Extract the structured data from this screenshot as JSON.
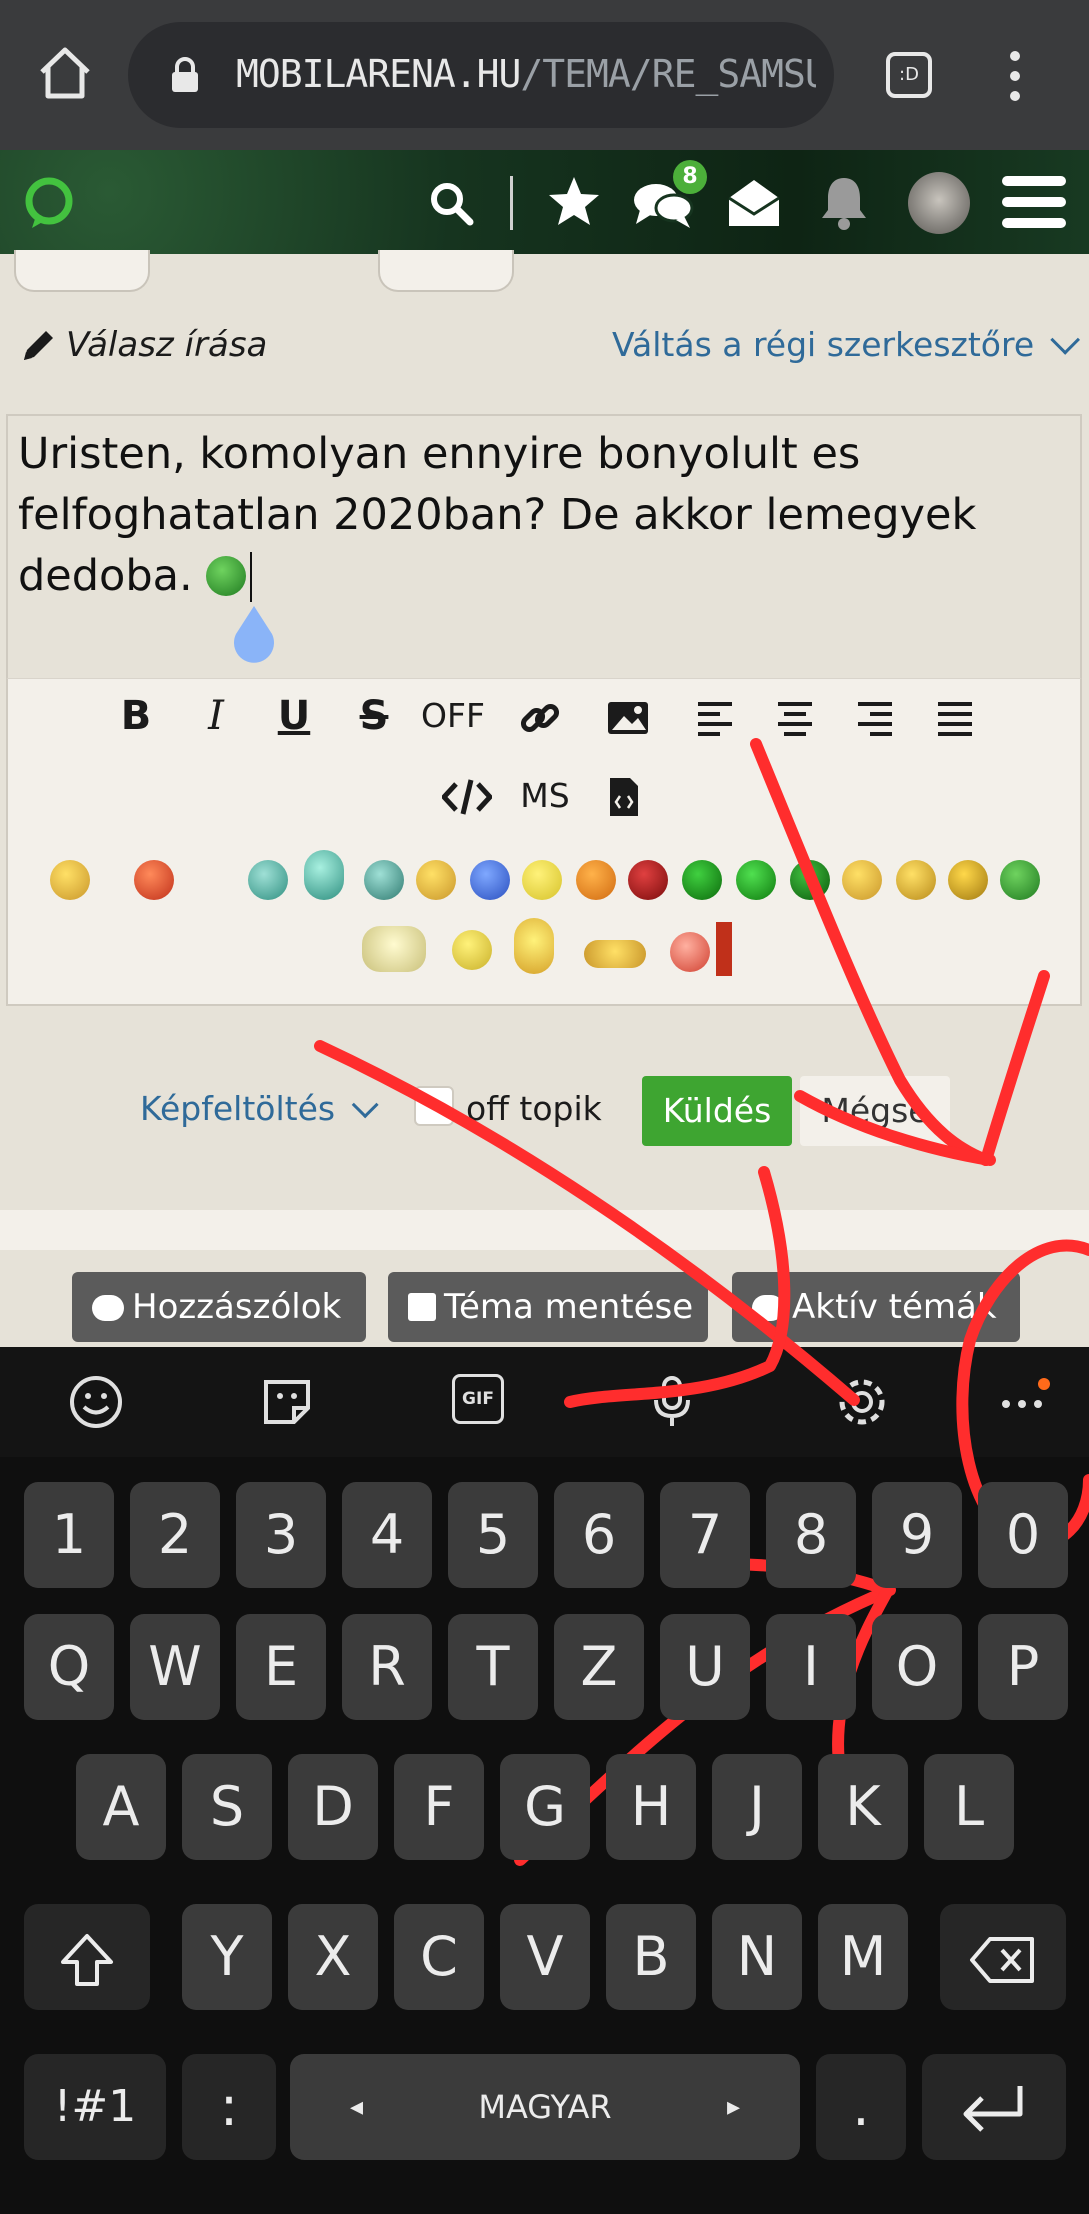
{
  "browser": {
    "url_host": "MOBILARENA.HU",
    "url_path": "/TEMA/RE_SAMSU",
    "tab_label": ":D"
  },
  "header": {
    "messages_badge": "8"
  },
  "reply": {
    "title": "Válasz írása",
    "switch_editor": "Váltás a régi szerkesztőre",
    "text": "Uristen, komolyan ennyire bonyolult es felfoghatatlan 2020ban? De akkor lemegyek dedoba."
  },
  "toolbar": {
    "off_label": "OFF",
    "ms_label": "MS"
  },
  "actions": {
    "upload": "Képfeltöltés",
    "offtopic": "off topik",
    "send": "Küldés",
    "cancel": "Mégse"
  },
  "bottom_bar": {
    "comments": "Hozzászólok",
    "save_topic": "Téma mentése",
    "active_topics": "Aktív témák"
  },
  "keyboard": {
    "gif_label": "GIF",
    "row_numbers": [
      "1",
      "2",
      "3",
      "4",
      "5",
      "6",
      "7",
      "8",
      "9",
      "0"
    ],
    "row_top": [
      "Q",
      "W",
      "E",
      "R",
      "T",
      "Z",
      "U",
      "I",
      "O",
      "P"
    ],
    "row_middle": [
      "A",
      "S",
      "D",
      "F",
      "G",
      "H",
      "J",
      "K",
      "L"
    ],
    "row_bottom": [
      "Y",
      "X",
      "C",
      "V",
      "B",
      "N",
      "M"
    ],
    "symbols_key": "!#1",
    "colon_key": ":",
    "language": "MAGYAR",
    "period_key": ".",
    "left_arrow": "◂",
    "right_arrow": "▸"
  },
  "colors": {
    "accent_send": "#3ea531",
    "link": "#2f6a99",
    "annotation": "#ff2d2d"
  }
}
